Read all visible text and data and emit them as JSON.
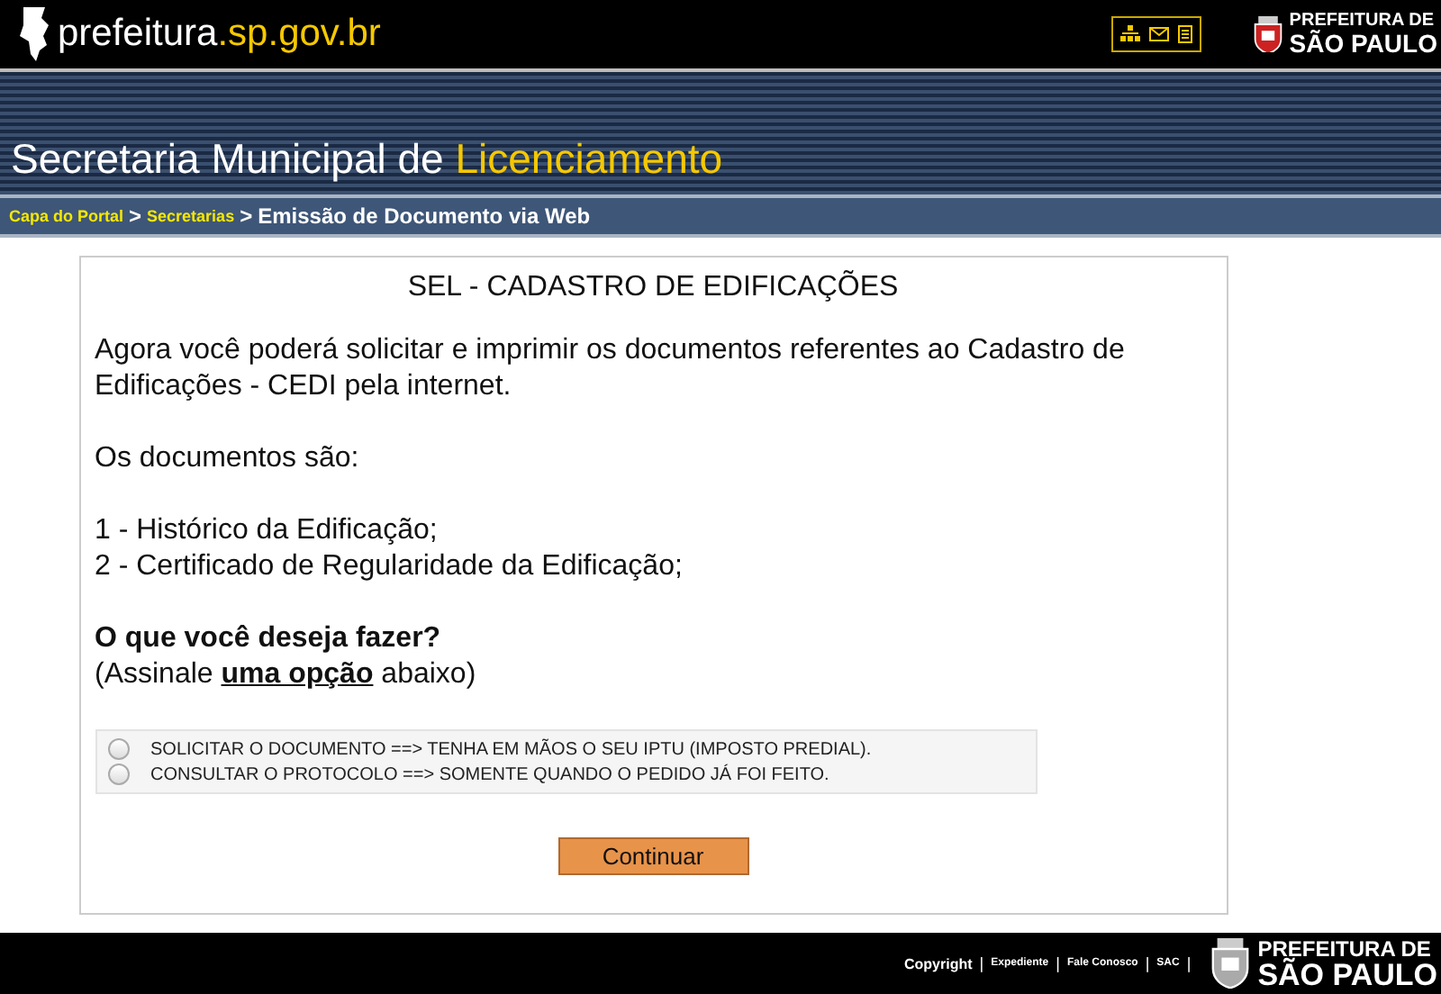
{
  "header": {
    "site_name": "prefeitura",
    "site_domain": ".sp.gov.br",
    "logo_line_1": "PREFEITURA DE",
    "logo_line_2": "SÃO PAULO"
  },
  "banner": {
    "title_start": "Secretaria Municipal de ",
    "title_highlight": "Licenciamento"
  },
  "breadcrumb_separator": ">",
  "breadcrumb": [
    {
      "label": "Capa do Portal",
      "kind": "link"
    },
    {
      "label": "Secretarias",
      "kind": "link"
    },
    {
      "label": "Emissão de Documento via Web",
      "kind": "current"
    }
  ],
  "form": {
    "title": "SEL - CADASTRO DE EDIFICAÇÕES",
    "intro": "Agora você poderá solicitar e imprimir os documentos referentes ao Cadastro de Edificações - CEDI pela internet.",
    "documents_heading": "Os documentos são:",
    "documents": [
      "1 - Histórico da Edificação;",
      "2 - Certificado de Regularidade da Edificação;"
    ],
    "question": "O que você deseja fazer?",
    "instruction": "(Assinale **uma opção** abaixo)",
    "options": [
      {
        "label": "SOLICITAR O DOCUMENTO ==> TENHA EM MÃOS O SEU IPTU (IMPOSTO PREDIAL).",
        "selected": false
      },
      {
        "label": "CONSULTAR O PROTOCOLO ==> SOMENTE QUANDO O PEDIDO JÁ FOI FEITO.",
        "selected": false
      }
    ],
    "submit": "Continuar"
  },
  "footer": {
    "separator": "|",
    "links": [
      "Copyright",
      "Expediente",
      "Fale Conosco",
      "SAC"
    ],
    "logo_line_1": "PREFEITURA DE",
    "logo_line_2": "SÃO PAULO"
  }
}
